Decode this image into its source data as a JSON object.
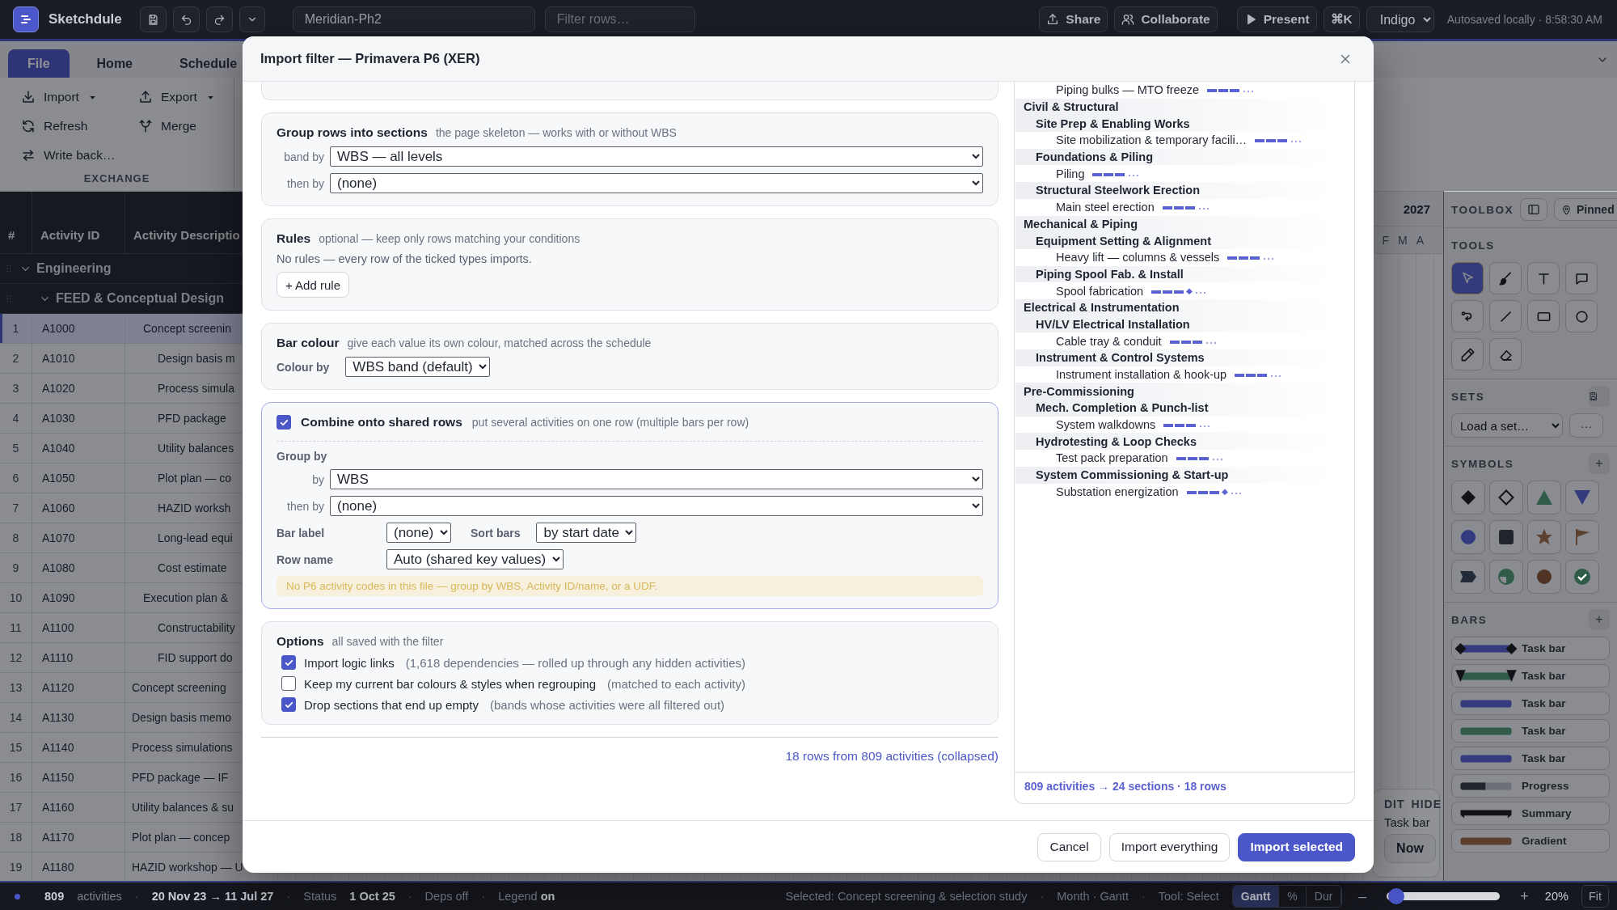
{
  "topbar": {
    "app_name": "Sketchdule",
    "project": "Meridian-Ph2",
    "filter_placeholder": "Filter rows…",
    "actions": [
      {
        "label": "Share",
        "kind": "share"
      },
      {
        "label": "Collaborate",
        "kind": "collaborate"
      },
      {
        "label": "Present",
        "kind": "present"
      },
      {
        "label": "⌘K",
        "kind": "palette"
      }
    ],
    "theme": "Indigo",
    "autosave": "Autosaved locally · 8:58:30 AM"
  },
  "ribbon": {
    "tabs": [
      {
        "label": "File",
        "selected": true
      },
      {
        "label": "Home",
        "selected": false
      },
      {
        "label": "Schedule",
        "selected": false
      }
    ],
    "commands": [
      {
        "label": "Import",
        "kind": "import",
        "menu": true
      },
      {
        "label": "Export",
        "kind": "export",
        "menu": true
      },
      {
        "label": "Refresh",
        "kind": "refresh",
        "menu": false
      },
      {
        "label": "Merge",
        "kind": "merge",
        "menu": false
      },
      {
        "label": "Write back…",
        "kind": "write-back",
        "menu": false
      }
    ],
    "group_label": "EXCHANGE"
  },
  "table": {
    "columns": [
      "#",
      "Activity ID",
      "Activity Descriptio"
    ],
    "groups": [
      {
        "label": "Engineering",
        "expanded": true,
        "children": [
          {
            "label": "FEED & Conceptual Design",
            "expanded": true
          }
        ]
      }
    ],
    "rows": [
      {
        "num": "1",
        "id": "A1000",
        "description": "Concept screenin",
        "kind": "lead",
        "selected": true
      },
      {
        "num": "2",
        "id": "A1010",
        "description": "Design basis m",
        "kind": "sub",
        "selected": false
      },
      {
        "num": "3",
        "id": "A1020",
        "description": "Process simula",
        "kind": "sub",
        "selected": false
      },
      {
        "num": "4",
        "id": "A1030",
        "description": "PFD package",
        "kind": "sub",
        "selected": false
      },
      {
        "num": "5",
        "id": "A1040",
        "description": "Utility balances",
        "kind": "sub",
        "selected": false
      },
      {
        "num": "6",
        "id": "A1050",
        "description": "Plot plan — co",
        "kind": "sub",
        "selected": false
      },
      {
        "num": "7",
        "id": "A1060",
        "description": "HAZID worksh",
        "kind": "sub",
        "selected": false
      },
      {
        "num": "8",
        "id": "A1070",
        "description": "Long-lead equi",
        "kind": "sub",
        "selected": false
      },
      {
        "num": "9",
        "id": "A1080",
        "description": "Cost estimate",
        "kind": "sub",
        "selected": false
      },
      {
        "num": "10",
        "id": "A1090",
        "description": "Execution plan &",
        "kind": "lead",
        "selected": false
      },
      {
        "num": "11",
        "id": "A1100",
        "description": "Constructability",
        "kind": "sub",
        "selected": false
      },
      {
        "num": "12",
        "id": "A1110",
        "description": "FID support do",
        "kind": "sub",
        "selected": false
      },
      {
        "num": "13",
        "id": "A1120",
        "description": "Concept screening",
        "kind": "plain",
        "selected": false
      },
      {
        "num": "14",
        "id": "A1130",
        "description": "Design basis memo",
        "kind": "plain",
        "selected": false
      },
      {
        "num": "15",
        "id": "A1140",
        "description": "Process simulations",
        "kind": "plain",
        "selected": false
      },
      {
        "num": "16",
        "id": "A1150",
        "description": "PFD package — IF",
        "kind": "plain",
        "selected": false
      },
      {
        "num": "17",
        "id": "A1160",
        "description": "Utility balances & su",
        "kind": "plain",
        "selected": false
      },
      {
        "num": "18",
        "id": "A1170",
        "description": "Plot plan — concep",
        "kind": "plain",
        "selected": false
      },
      {
        "num": "19",
        "id": "A1180",
        "description": "HAZID workshop — U",
        "kind": "plain",
        "selected": false
      }
    ]
  },
  "gantt": {
    "year": "2027",
    "months": [
      "F",
      "M",
      "A"
    ],
    "popup": {
      "actions": [
        "DIT",
        "HIDE"
      ],
      "item": "Task bar",
      "button": "Now"
    }
  },
  "toolbox": {
    "title": "TOOLBOX",
    "pinned": "Pinned",
    "tools_title": "TOOLS",
    "tools": [
      {
        "kind": "select",
        "selected": true
      },
      {
        "kind": "brush",
        "selected": false
      },
      {
        "kind": "text",
        "selected": false
      },
      {
        "kind": "comment",
        "selected": false
      },
      {
        "kind": "connector",
        "selected": false
      },
      {
        "kind": "line",
        "selected": false
      },
      {
        "kind": "rectangle",
        "selected": false
      },
      {
        "kind": "circle",
        "selected": false
      },
      {
        "kind": "pencil",
        "selected": false
      },
      {
        "kind": "eraser",
        "selected": false
      }
    ],
    "sets_title": "SETS",
    "sets_select": "Load a set…",
    "sets_more": "···",
    "symbols_title": "SYMBOLS",
    "symbols_add": "+",
    "symbols": [
      {
        "kind": "diamond",
        "color": "#111318"
      },
      {
        "kind": "diamond-outline",
        "color": "#111318"
      },
      {
        "kind": "triangle",
        "color": "#2f5b48"
      },
      {
        "kind": "triangle-down",
        "color": "#333b7c"
      },
      {
        "kind": "circle",
        "color": "#333b7c"
      },
      {
        "kind": "square",
        "color": "#22252b"
      },
      {
        "kind": "star",
        "color": "#5c4030"
      },
      {
        "kind": "flag",
        "color": "#5c4030"
      },
      {
        "kind": "tag",
        "color": "#232a38"
      },
      {
        "kind": "pie",
        "color": "#2f5b48"
      },
      {
        "kind": "dot",
        "color": "#4f3426"
      },
      {
        "kind": "check",
        "color": "#2f5b48"
      }
    ],
    "bars_title": "BARS",
    "bars_add": "+",
    "bars": [
      {
        "label": "Task bar",
        "kind": "diamond-ends",
        "color": "#333b7c"
      },
      {
        "label": "Task bar",
        "kind": "triangle-ends",
        "color": "#2f5b48"
      },
      {
        "label": "Task bar",
        "kind": "plain",
        "color": "#333b7c"
      },
      {
        "label": "Task bar",
        "kind": "plain",
        "color": "#2f5b48"
      },
      {
        "label": "Task bar",
        "kind": "plain",
        "color": "#333b7c"
      },
      {
        "label": "Progress",
        "kind": "progress",
        "color": "#22252b"
      },
      {
        "label": "Summary",
        "kind": "summary",
        "color": "#111318"
      },
      {
        "label": "Gradient",
        "kind": "gradient",
        "color": "#5c4030"
      }
    ]
  },
  "dialog": {
    "title": "Import filter — Primavera P6 (XER)",
    "grouping": {
      "title": "Group rows into sections",
      "hint": "the page skeleton — works with or without WBS",
      "fields": [
        {
          "label": "band by",
          "value": "WBS — all levels"
        },
        {
          "label": "then by",
          "value": "(none)"
        }
      ]
    },
    "rules": {
      "title": "Rules",
      "hint": "optional — keep only rows matching your conditions",
      "empty": "No rules — every row of the ticked types imports.",
      "add": "+ Add rule"
    },
    "bar_colour": {
      "title": "Bar colour",
      "hint": "give each value its own colour, matched across the schedule",
      "label": "Colour by",
      "value": "WBS band (default)"
    },
    "combine": {
      "checked": true,
      "title": "Combine onto shared rows",
      "hint": "put several activities on one row (multiple bars per row)",
      "group_title": "Group by",
      "fields": [
        {
          "label": "by",
          "value": "WBS"
        },
        {
          "label": "then by",
          "value": "(none)"
        }
      ],
      "bar_label": {
        "label": "Bar label",
        "value": "(none)"
      },
      "sort_bars": {
        "label": "Sort bars",
        "value": "by start date"
      },
      "row_name": {
        "label": "Row name",
        "value": "Auto (shared key values)"
      },
      "note": "No P6 activity codes in this file — group by WBS, Activity ID/name, or a UDF."
    },
    "options": {
      "title": "Options",
      "hint": "all saved with the filter",
      "items": [
        {
          "label": "Import logic links",
          "hint": "(1,618 dependencies — rolled up through any hidden activities)",
          "checked": true
        },
        {
          "label": "Keep my current bar colours & styles when regrouping",
          "hint": "(matched to each activity)",
          "checked": false
        },
        {
          "label": "Drop sections that end up empty",
          "hint": "(bands whose activities were all filtered out)",
          "checked": true
        }
      ]
    },
    "summary": "18 rows from 809 activities (collapsed)",
    "preview": {
      "tree": [
        {
          "label": "Piping bulks — MTO freeze",
          "kind": "activity",
          "milestone": false
        },
        {
          "label": "Civil & Structural",
          "kind": "discipline",
          "children": [
            {
              "label": "Site Prep & Enabling Works",
              "kind": "area",
              "children": [
                {
                  "label": "Site mobilization & temporary facili…",
                  "kind": "activity",
                  "milestone": false
                }
              ]
            },
            {
              "label": "Foundations & Piling",
              "kind": "area",
              "children": [
                {
                  "label": "Piling",
                  "kind": "activity",
                  "milestone": false
                }
              ]
            },
            {
              "label": "Structural Steelwork Erection",
              "kind": "area",
              "children": [
                {
                  "label": "Main steel erection",
                  "kind": "activity",
                  "milestone": false
                }
              ]
            }
          ]
        },
        {
          "label": "Mechanical & Piping",
          "kind": "discipline",
          "children": [
            {
              "label": "Equipment Setting & Alignment",
              "kind": "area",
              "children": [
                {
                  "label": "Heavy lift — columns & vessels",
                  "kind": "activity",
                  "milestone": false
                }
              ]
            },
            {
              "label": "Piping Spool Fab. & Install",
              "kind": "area",
              "children": [
                {
                  "label": "Spool fabrication",
                  "kind": "activity",
                  "milestone": true
                }
              ]
            }
          ]
        },
        {
          "label": "Electrical & Instrumentation",
          "kind": "discipline",
          "children": [
            {
              "label": "HV/LV Electrical Installation",
              "kind": "area",
              "children": [
                {
                  "label": "Cable tray & conduit",
                  "kind": "activity",
                  "milestone": false
                }
              ]
            },
            {
              "label": "Instrument & Control Systems",
              "kind": "area",
              "children": [
                {
                  "label": "Instrument installation & hook-up",
                  "kind": "activity",
                  "milestone": false
                }
              ]
            }
          ]
        },
        {
          "label": "Pre-Commissioning",
          "kind": "discipline",
          "children": [
            {
              "label": "Mech. Completion & Punch-list",
              "kind": "area",
              "children": [
                {
                  "label": "System walkdowns",
                  "kind": "activity",
                  "milestone": false
                }
              ]
            },
            {
              "label": "Hydrotesting & Loop Checks",
              "kind": "area",
              "children": [
                {
                  "label": "Test pack preparation",
                  "kind": "activity",
                  "milestone": false
                }
              ]
            },
            {
              "label": "System Commissioning & Start-up",
              "kind": "area",
              "children": [
                {
                  "label": "Substation energization",
                  "kind": "activity",
                  "milestone": true
                }
              ]
            }
          ]
        }
      ],
      "footer": "809 activities → 24 sections · 18 rows"
    },
    "buttons": [
      {
        "label": "Cancel",
        "kind": "secondary"
      },
      {
        "label": "Import everything",
        "kind": "secondary"
      },
      {
        "label": "Import selected",
        "kind": "primary"
      }
    ]
  },
  "status_bar": {
    "left": [
      {
        "text": "809",
        "kind": "value"
      },
      {
        "text": "activities",
        "kind": "label"
      },
      {
        "text": "·",
        "kind": "sep"
      },
      {
        "text": "20 Nov 23 → 11 Jul 27",
        "kind": "value"
      },
      {
        "text": "·",
        "kind": "sep"
      },
      {
        "text": "Status",
        "kind": "label"
      },
      {
        "text": "1 Oct 25",
        "kind": "value"
      },
      {
        "text": "·",
        "kind": "sep"
      },
      {
        "text": "Deps off",
        "kind": "label"
      },
      {
        "text": "·",
        "kind": "sep"
      },
      {
        "text": "Legend **on**",
        "kind": "label"
      }
    ],
    "right": [
      {
        "text": "Selected: Concept screening & selection study",
        "kind": "label"
      },
      {
        "text": "·",
        "kind": "sep"
      },
      {
        "text": "Month · Gantt",
        "kind": "label"
      },
      {
        "text": "·",
        "kind": "sep"
      },
      {
        "text": "Tool: Select",
        "kind": "label"
      }
    ],
    "views": [
      {
        "label": "Gantt",
        "selected": true
      },
      {
        "label": "%",
        "selected": false
      },
      {
        "label": "Dur",
        "selected": false
      }
    ],
    "zoom": {
      "minus": "–",
      "level": 0.05,
      "plus": "+",
      "reading": "20%",
      "fit": "Fit"
    }
  }
}
